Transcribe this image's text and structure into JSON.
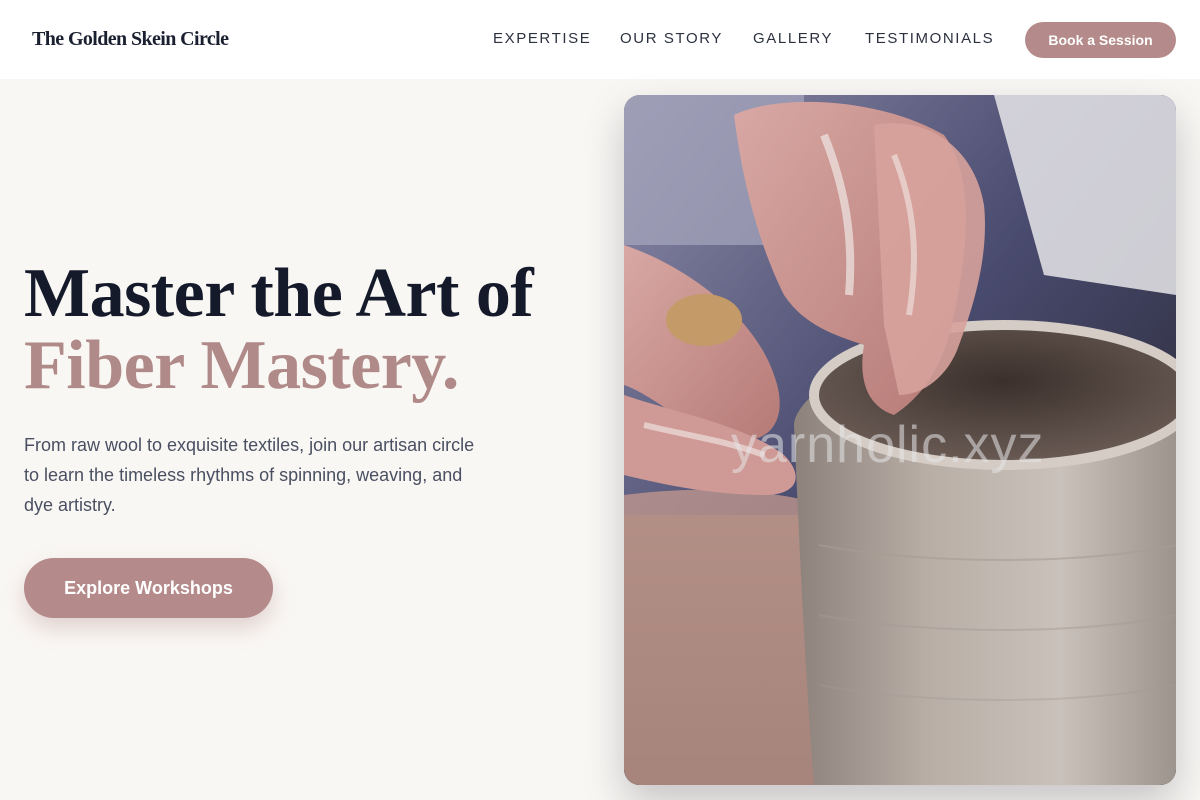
{
  "header": {
    "brand": "The Golden Skein Circle",
    "nav": [
      "EXPERTISE",
      "OUR STORY",
      "GALLERY",
      "TESTIMONIALS"
    ],
    "cta_label": "Book a Session"
  },
  "hero": {
    "title_line1": "Master the Art of",
    "title_line2": "Fiber Mastery.",
    "description": "From raw wool to exquisite textiles, join our artisan circle to learn the timeless rhythms of spinning, weaving, and dye artistry.",
    "button_label": "Explore Workshops",
    "image": {
      "subject": "hands shaping a clay pot on a pottery wheel",
      "watermark": "yarnholic.xyz"
    }
  },
  "colors": {
    "accent": "#b48a8a",
    "heading": "#151a2b",
    "body_text": "#4a5062",
    "background": "#f9f7f4",
    "header_bg": "#ffffff"
  }
}
